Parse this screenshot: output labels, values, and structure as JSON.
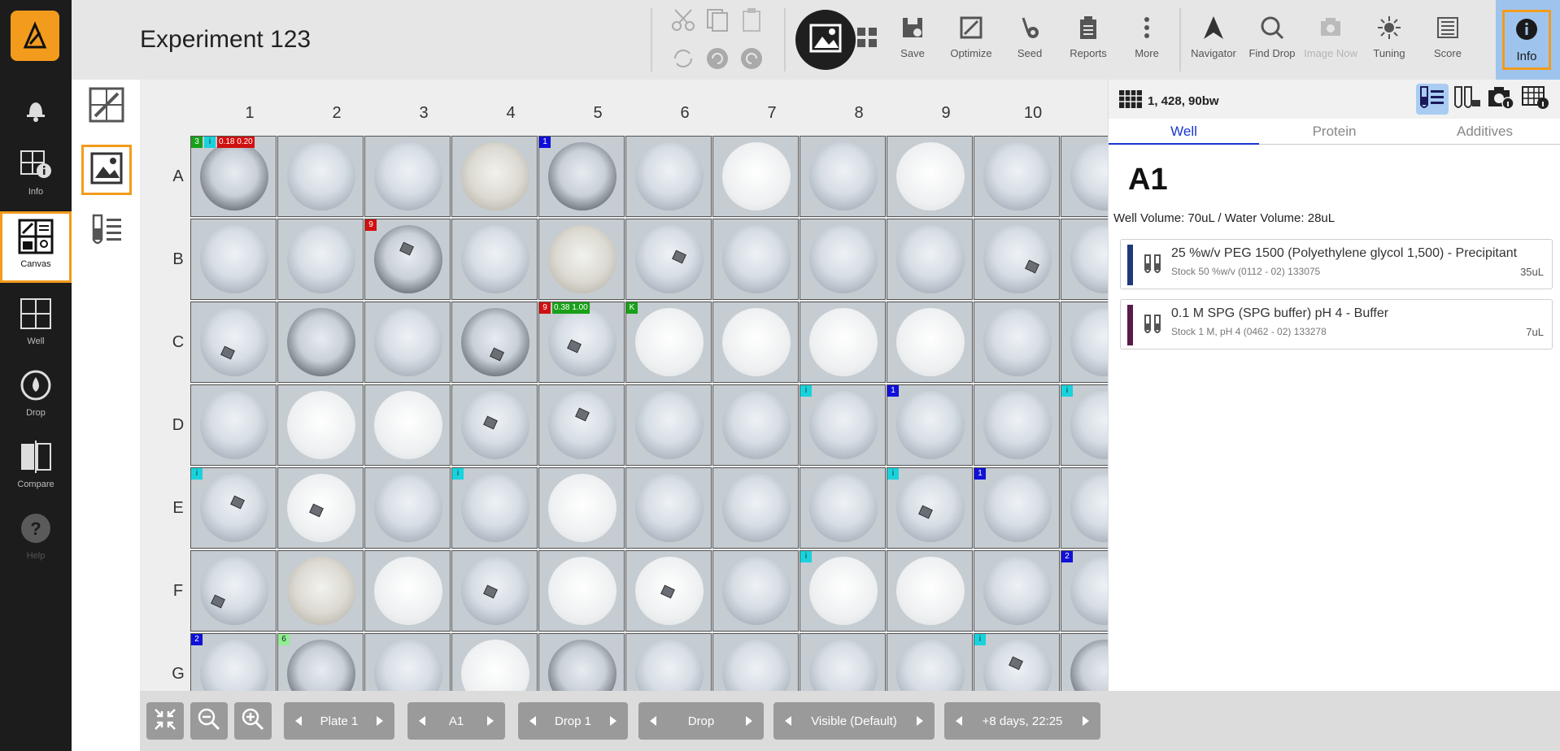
{
  "app": {
    "title": "Experiment 123",
    "brand_color": "#f29b1d",
    "selected_color": "#9ec4ee",
    "sidebar": [
      {
        "name": "notifications",
        "label": "",
        "icon": "bell-icon"
      },
      {
        "name": "info",
        "label": "Info",
        "icon": "plate-info-icon"
      },
      {
        "name": "canvas",
        "label": "Canvas",
        "icon": "canvas-icon",
        "active": true
      },
      {
        "name": "well",
        "label": "Well",
        "icon": "well-icon"
      },
      {
        "name": "drop",
        "label": "Drop",
        "icon": "drop-icon"
      },
      {
        "name": "compare",
        "label": "Compare",
        "icon": "compare-icon"
      },
      {
        "name": "help",
        "label": "Help",
        "icon": "help-icon"
      }
    ]
  },
  "toolbar": {
    "save": "Save",
    "optimize": "Optimize",
    "seed": "Seed",
    "reports": "Reports",
    "more": "More",
    "navigator": "Navigator",
    "find_drop": "Find Drop",
    "image_now": "Image Now",
    "tuning": "Tuning",
    "score": "Score",
    "info": "Info"
  },
  "canvas": {
    "columns": [
      "1",
      "2",
      "3",
      "4",
      "5",
      "6",
      "7",
      "8",
      "9",
      "10"
    ],
    "rows": [
      "A",
      "B",
      "C",
      "D",
      "E",
      "F",
      "G"
    ],
    "tags": {
      "A1": [
        "3",
        "i",
        "0.18 0.20"
      ],
      "A5": "1",
      "B3": "9",
      "C5": [
        "9",
        "0.38 1.00"
      ],
      "C6": "K",
      "D8": "i",
      "D9": "1",
      "D11": "i",
      "E1": "i",
      "E4": "i",
      "E9": "i",
      "E10": "1",
      "F8": "i",
      "F11": "2",
      "G1": "2",
      "G2": "6",
      "G10": "i"
    }
  },
  "panel": {
    "plate_info": "1, 428, 90bw",
    "tabs": [
      "Well",
      "Protein",
      "Additives"
    ],
    "well_name": "A1",
    "well_volume": "Well Volume: 70uL / Water Volume: 28uL",
    "components": [
      {
        "name": "25 %w/v  PEG 1500 (Polyethylene glycol 1,500) - Precipitant",
        "stock": "Stock 50 %w/v (0112 - 02) 133075",
        "volume": "35uL",
        "color": "#1f3a7a"
      },
      {
        "name": "0.1 M  SPG (SPG buffer) pH 4 - Buffer",
        "stock": "Stock 1 M, pH 4 (0462 - 02) 133278",
        "volume": "7uL",
        "color": "#5a1a4a"
      }
    ]
  },
  "bottombar": {
    "plate": "Plate 1",
    "well": "A1",
    "drop": "Drop 1",
    "image_type": "Drop",
    "visibility": "Visible (Default)",
    "time": "+8 days, 22:25"
  }
}
